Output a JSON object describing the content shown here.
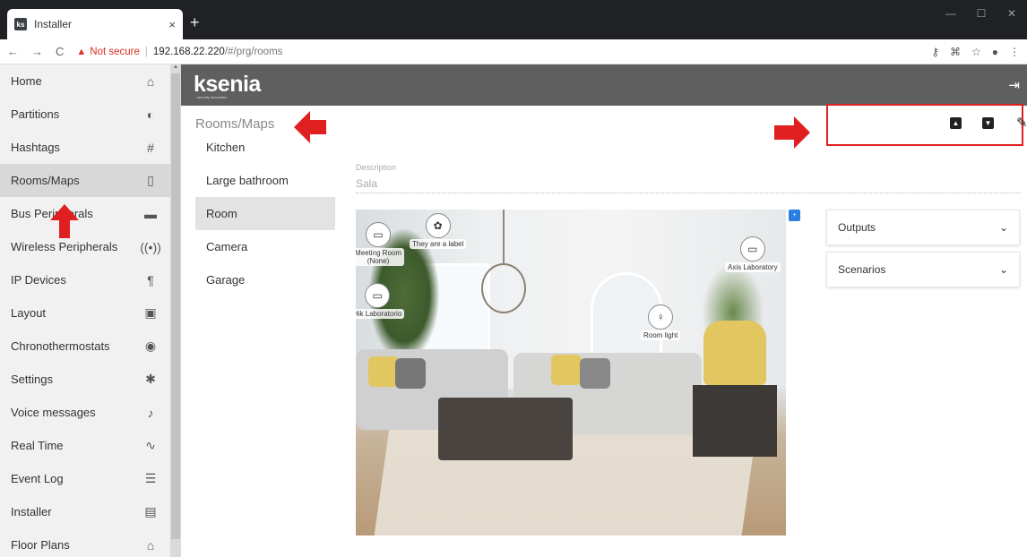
{
  "browser": {
    "tab_title": "Installer",
    "tab_favicon": "ks",
    "tab_close": "×",
    "new_tab": "+",
    "window_controls": [
      "—",
      "☐",
      "✕"
    ],
    "nav": [
      "←",
      "→",
      "C"
    ],
    "security_warning": "Not secure",
    "url_host": "192.168.22.220",
    "url_path": "/#/prg/rooms",
    "addr_icons": [
      "key-icon",
      "translate-icon",
      "star-icon",
      "account-icon",
      "menu-icon"
    ]
  },
  "header": {
    "logo": "ksenia",
    "logo_sub": "security innovation"
  },
  "sidebar": {
    "items": [
      {
        "label": "Home",
        "icon": "home-icon",
        "glyph": "⌂"
      },
      {
        "label": "Partitions",
        "icon": "pie-icon",
        "glyph": "◐"
      },
      {
        "label": "Hashtags",
        "icon": "hash-icon",
        "glyph": "#"
      },
      {
        "label": "Rooms/Maps",
        "icon": "door-icon",
        "glyph": "▯",
        "active": true
      },
      {
        "label": "Bus Peripherals",
        "icon": "device-icon",
        "glyph": "▬"
      },
      {
        "label": "Wireless Peripherals",
        "icon": "wireless-icon",
        "glyph": "((•))"
      },
      {
        "label": "IP Devices",
        "icon": "ip-device-icon",
        "glyph": "¶"
      },
      {
        "label": "Layout",
        "icon": "briefcase-icon",
        "glyph": "▣"
      },
      {
        "label": "Chronothermostats",
        "icon": "thermostat-icon",
        "glyph": "◉"
      },
      {
        "label": "Settings",
        "icon": "gear-icon",
        "glyph": "✱"
      },
      {
        "label": "Voice messages",
        "icon": "voice-icon",
        "glyph": "♪"
      },
      {
        "label": "Real Time",
        "icon": "pulse-icon",
        "glyph": "∿"
      },
      {
        "label": "Event Log",
        "icon": "log-icon",
        "glyph": "☰"
      },
      {
        "label": "Installer",
        "icon": "installer-icon",
        "glyph": "▤"
      },
      {
        "label": "Floor Plans",
        "icon": "floorplan-icon",
        "glyph": "⌂"
      }
    ]
  },
  "main": {
    "title": "Rooms/Maps",
    "rooms": [
      "Kitchen",
      "Large bathroom",
      "Room",
      "Camera",
      "Garage"
    ],
    "active_room": "Room",
    "description_label": "Description",
    "description_value": "Sala",
    "markers": [
      {
        "icon": "camera-icon",
        "glyph": "▭",
        "label": "Meeting Room\n(None)"
      },
      {
        "icon": "label-icon",
        "glyph": "✿",
        "label": "They are a label"
      },
      {
        "icon": "camera-icon",
        "glyph": "▭",
        "label": "Hik Laboratorio"
      },
      {
        "icon": "camera-icon",
        "glyph": "▭",
        "label": "Axis Laboratory"
      },
      {
        "icon": "lightbulb-icon",
        "glyph": "♀",
        "label": "Room light"
      }
    ],
    "panels": [
      {
        "label": "Outputs",
        "chevron": "⌄"
      },
      {
        "label": "Scenarios",
        "chevron": "⌄"
      }
    ]
  },
  "colors": {
    "annotation_red": "#e02020",
    "header_gray": "#5f5f5f",
    "sidebar_bg": "#f1f1f1"
  }
}
